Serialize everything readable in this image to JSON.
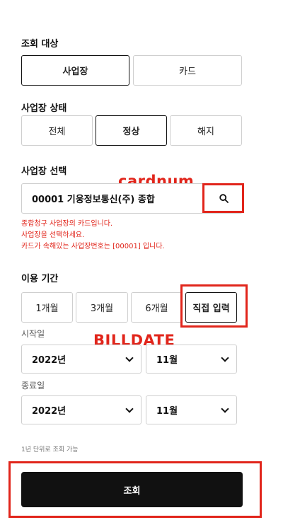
{
  "inquiry_target": {
    "label": "조회 대상",
    "options": [
      "사업장",
      "카드"
    ],
    "selected": "사업장"
  },
  "business_status": {
    "label": "사업장 상태",
    "options": [
      "전체",
      "정상",
      "해지"
    ],
    "selected": "정상"
  },
  "business_select": {
    "label": "사업장 선택",
    "value": "00001 기웅정보통신(주) 종합",
    "search_icon": "search-icon",
    "notes": [
      "종합청구 사업장의 카드입니다.",
      "사업장을 선택하세요.",
      "카드가 속해있는 사업장번호는 [00001] 입니다."
    ]
  },
  "period": {
    "label": "이용 기간",
    "options": [
      "1개월",
      "3개월",
      "6개월",
      "직접 입력"
    ],
    "selected": "직접 입력"
  },
  "start_date": {
    "label": "시작일",
    "year": "2022년",
    "month": "11월"
  },
  "end_date": {
    "label": "종료일",
    "year": "2022년",
    "month": "11월"
  },
  "hint": "1년 단위로 조회 가능",
  "submit_label": "조회",
  "annotations": {
    "cardnum": "cardnum",
    "billdate": "BILLDATE",
    "color": "#e1251b"
  }
}
